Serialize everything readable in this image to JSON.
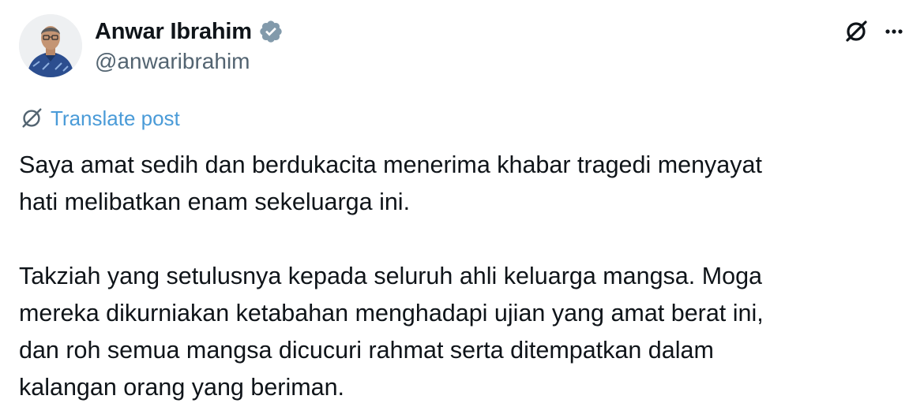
{
  "author": {
    "display_name": "Anwar Ibrahim",
    "handle": "@anwaribrahim",
    "verified": true,
    "avatar": "avatar-photo"
  },
  "actions": {
    "grok_icon": "grok-slash-icon",
    "more_icon": "more-dots-icon"
  },
  "translate": {
    "label": "Translate post",
    "icon": "translate-icon"
  },
  "post": {
    "text": "Saya amat sedih dan berdukacita menerima khabar tragedi menyayat\nhati melibatkan enam sekeluarga ini.\n\nTakziah yang setulusnya kepada seluruh ahli keluarga mangsa. Moga\nmereka dikurniakan ketabahan menghadapi ujian yang amat berat ini,\ndan roh semua mangsa dicucuri rahmat serta ditempatkan dalam\nkalangan orang yang beriman."
  },
  "colors": {
    "text_primary": "#0f1419",
    "text_secondary": "#536471",
    "link": "#4a9bd8",
    "verified_badge": "#829aab"
  }
}
